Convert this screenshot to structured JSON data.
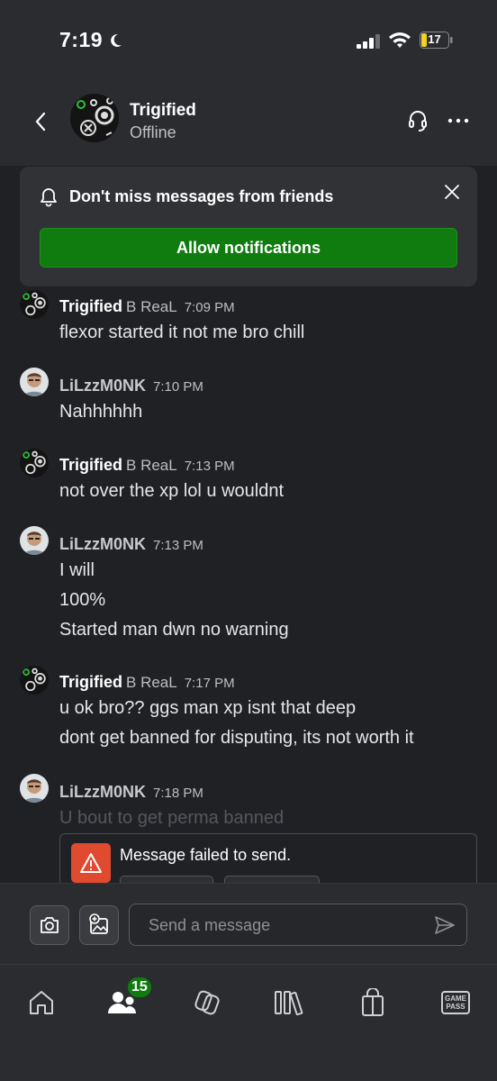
{
  "status_bar": {
    "time": "7:19",
    "battery": "17"
  },
  "header": {
    "name": "Trigified",
    "presence": "Offline"
  },
  "notification": {
    "text": "Don't miss messages from friends",
    "button": "Allow notifications"
  },
  "messages": [
    {
      "sender": "Trigified",
      "tag": "B ReaL",
      "time": "7:09 PM",
      "lines": [
        "flexor started it not me bro chill"
      ]
    },
    {
      "sender": "LiLzzM0NK",
      "tag": "",
      "time": "7:10 PM",
      "lines": [
        "Nahhhhhh"
      ]
    },
    {
      "sender": "Trigified",
      "tag": "B ReaL",
      "time": "7:13 PM",
      "lines": [
        "not over the xp lol u wouldnt"
      ]
    },
    {
      "sender": "LiLzzM0NK",
      "tag": "",
      "time": "7:13 PM",
      "lines": [
        "I will",
        "100%",
        "Started man dwn no warning"
      ]
    },
    {
      "sender": "Trigified",
      "tag": "B ReaL",
      "time": "7:17 PM",
      "lines": [
        "u ok bro?? ggs man xp isnt that deep",
        "dont get banned for disputing, its not worth it"
      ]
    },
    {
      "sender": "LiLzzM0NK",
      "tag": "",
      "time": "7:18 PM",
      "lines": [
        "U bout to get perma banned"
      ]
    }
  ],
  "failed": {
    "text": "Message failed to send."
  },
  "composer": {
    "placeholder": "Send a message"
  },
  "nav": {
    "friends_badge": "15",
    "gamepass_line1": "GAME",
    "gamepass_line2": "PASS"
  }
}
